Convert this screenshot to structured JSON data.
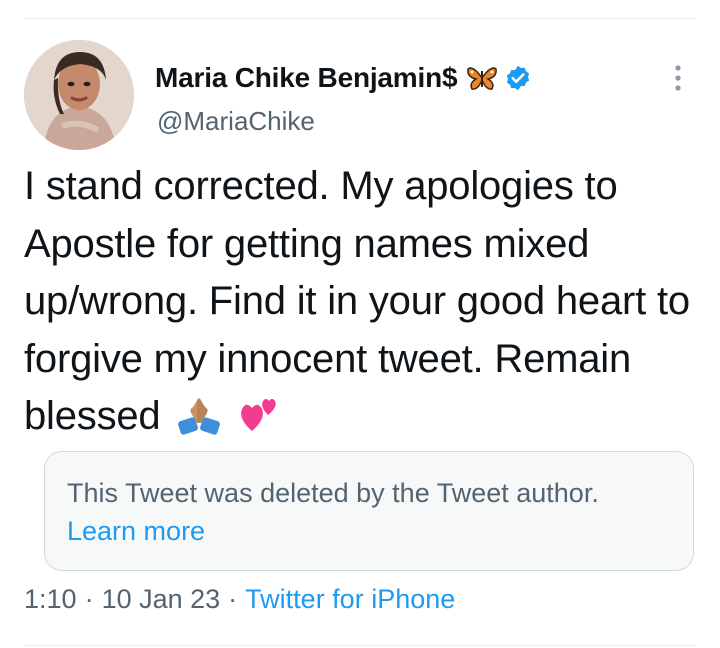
{
  "author": {
    "display_name": "Maria Chike Benjamin$",
    "handle": "@MariaChike",
    "name_emoji": "butterfly-icon",
    "verified": true
  },
  "tweet": {
    "text": "I stand corrected. My apologies to Apostle for getting names mixed up/wrong. Find it in your good heart to forgive my innocent tweet. Remain blessed",
    "trailing_emojis": [
      "folded-hands-icon",
      "two-hearts-icon"
    ]
  },
  "quoted_notice": {
    "text": "This Tweet was deleted by the Tweet author.",
    "link": "Learn more"
  },
  "meta": {
    "time": "1:10",
    "separator": "·",
    "date": "10 Jan 23",
    "source": "Twitter for iPhone"
  },
  "colors": {
    "accent": "#1d9bf0",
    "secondary_text": "#536471",
    "border": "#cfd9de"
  }
}
